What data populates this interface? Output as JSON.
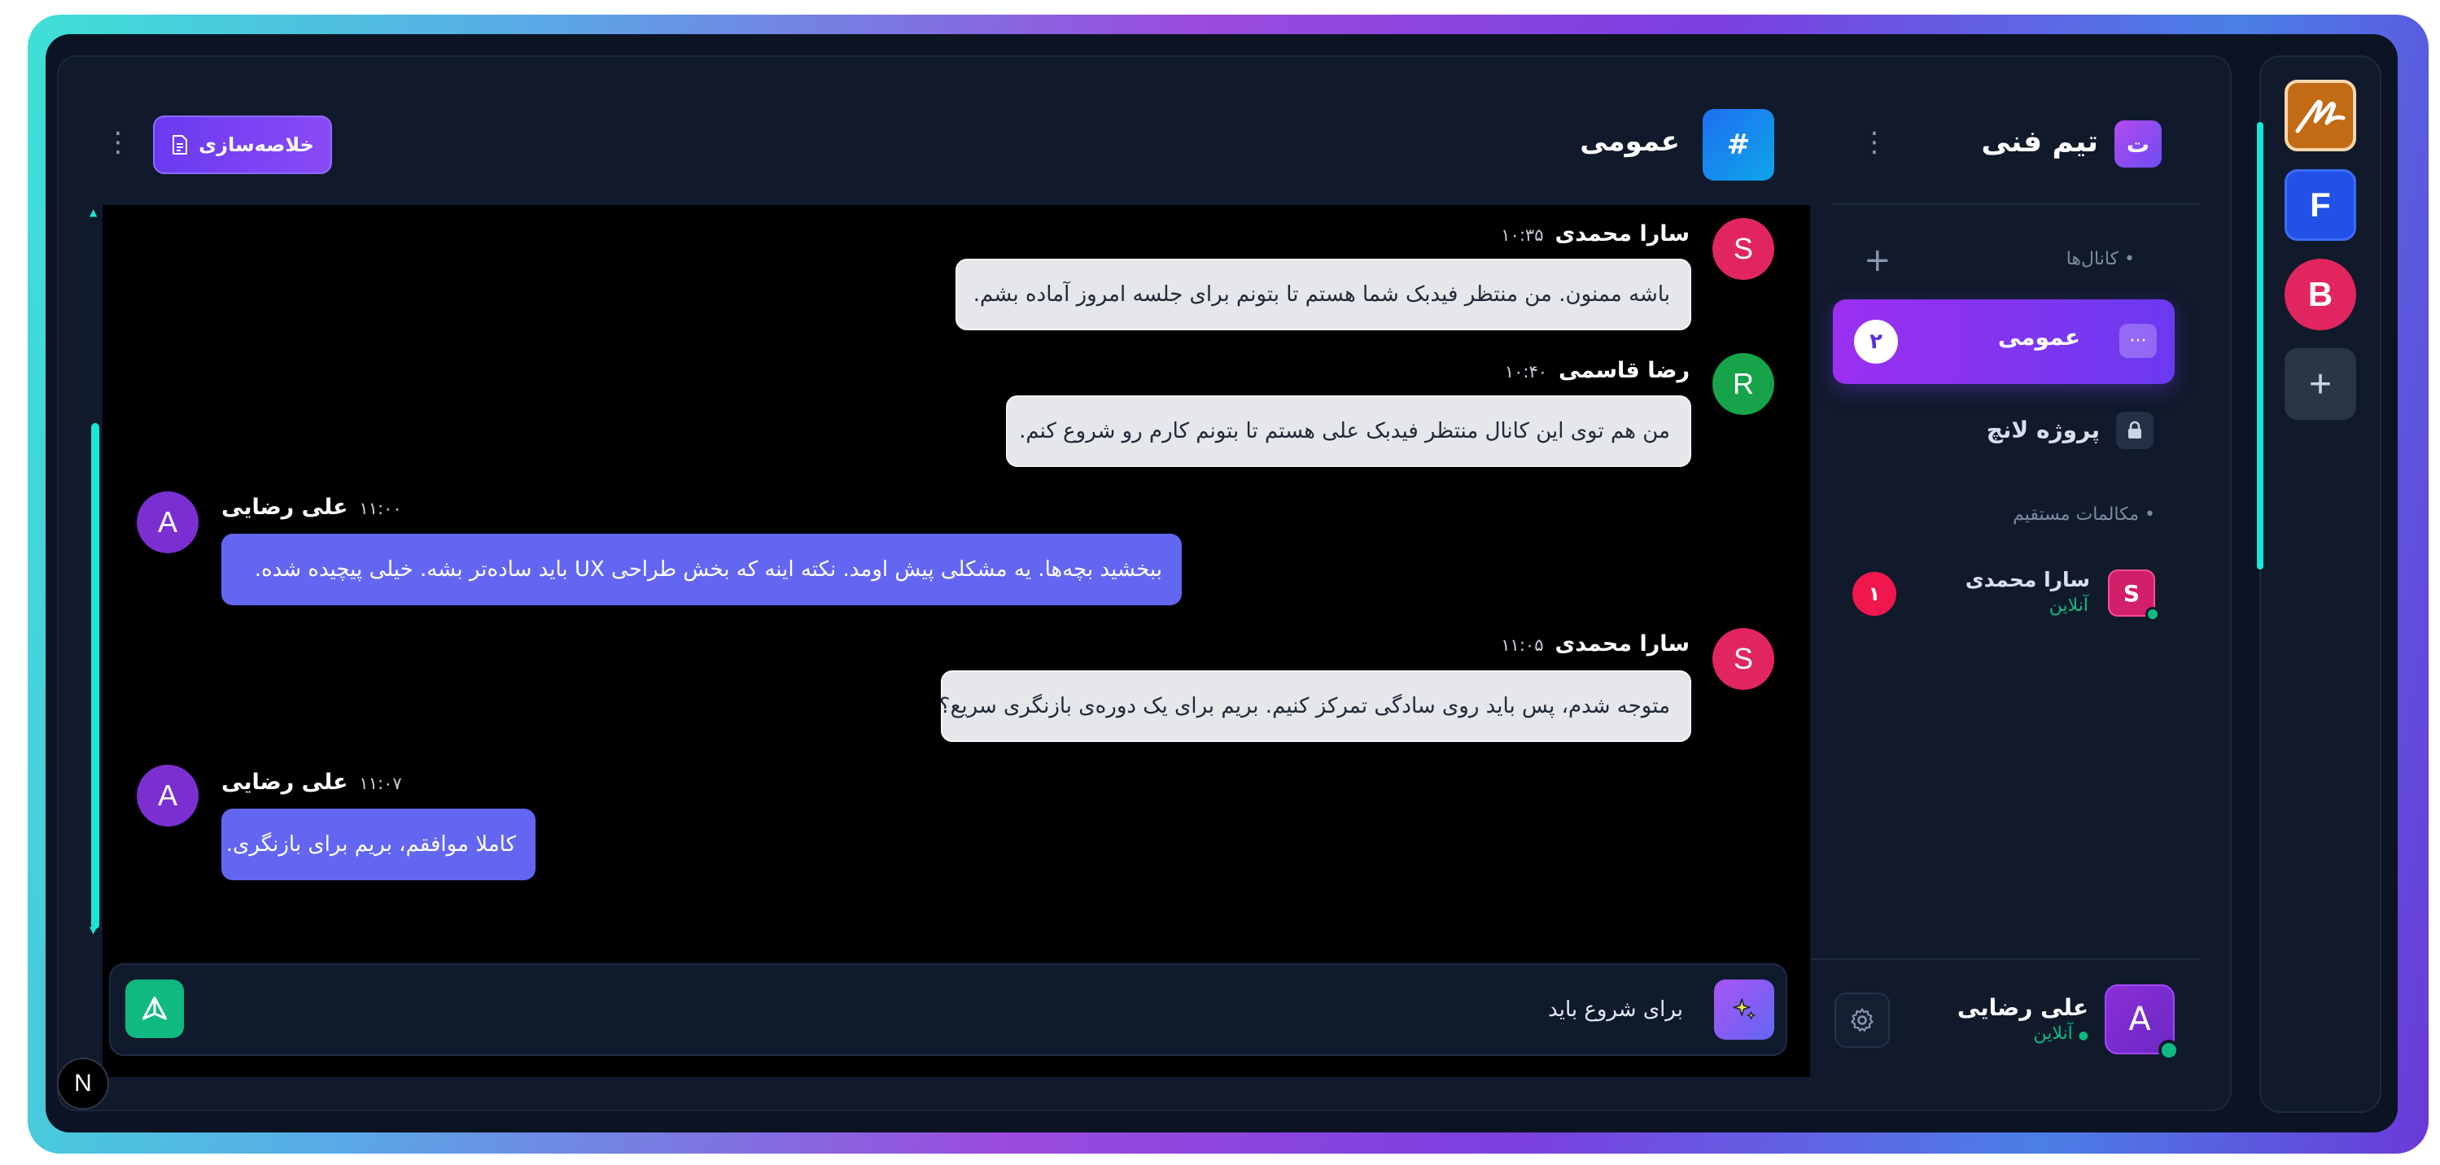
{
  "servers": {
    "items": [
      {
        "label": "",
        "icon": "brand-logo-icon"
      },
      {
        "label": "F"
      },
      {
        "label": "B"
      },
      {
        "label": "+"
      }
    ]
  },
  "sidebar": {
    "team_initial": "ت",
    "team_name": "تیم فنی",
    "channels_label": "کانال‌ها",
    "add_label": "+",
    "channels": [
      {
        "name": "عمومی",
        "unread": "۲",
        "menu": "···",
        "active": true
      },
      {
        "name": "پروژه لانچ",
        "private": true
      }
    ],
    "dm_label": "مکالمات مستقیم",
    "dms": [
      {
        "initial": "S",
        "name": "سارا محمدی",
        "status": "آنلاین",
        "unread": "۱"
      }
    ],
    "me": {
      "initial": "A",
      "name": "علی رضایی",
      "status": "آنلاین"
    }
  },
  "header": {
    "hash": "#",
    "channel_title": "عمومی",
    "summarize_label": "خلاصه‌سازی"
  },
  "messages": [
    {
      "initial": "S",
      "author": "سارا محمدی",
      "time": "۱۰:۳۵",
      "text": "باشه ممنون. من منتظر فیدبک شما هستم تا بتونم برای جلسه امروز آماده بشم.",
      "side": "right"
    },
    {
      "initial": "R",
      "author": "رضا قاسمی",
      "time": "۱۰:۴۰",
      "text": "من هم توی این کانال منتظر فیدبک علی هستم تا بتونم کارم رو شروع کنم.",
      "side": "right"
    },
    {
      "initial": "A",
      "author": "علی رضایی",
      "time": "۱۱:۰۰",
      "text": "ببخشید بچه‌ها. یه مشکلی پیش اومد. نکته اینه که بخش طراحی UX باید ساده‌تر بشه. خیلی پیچیده شده.",
      "side": "left"
    },
    {
      "initial": "S",
      "author": "سارا محمدی",
      "time": "۱۱:۰۵",
      "text": "متوجه شدم، پس باید روی سادگی تمرکز کنیم. بریم برای یک دوره‌ی بازنگری سریع؟",
      "side": "right"
    },
    {
      "initial": "A",
      "author": "علی رضایی",
      "time": "۱۱:۰۷",
      "text": "کاملا موافقم، بریم برای بازنگری.",
      "side": "left"
    }
  ],
  "composer": {
    "text": "برای شروع باید"
  },
  "overlay": {
    "n_badge": "N"
  },
  "colors": {
    "accent": "#6a3af0",
    "online": "#10b981",
    "scroll": "#19e6d6",
    "outgoing_bubble": "#6366f1",
    "incoming_bubble": "#e5e7eb"
  }
}
